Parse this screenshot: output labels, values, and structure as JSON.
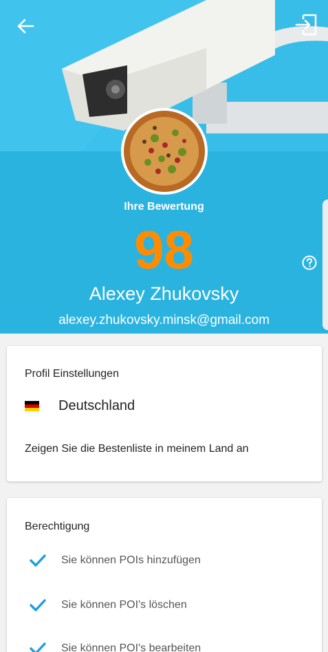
{
  "header": {
    "back_icon": "arrow-left-icon",
    "logout_icon": "exit-icon",
    "score_label": "Ihre Bewertung",
    "score": "98",
    "help_icon": "question-circle-icon",
    "user_name": "Alexey Zhukovsky",
    "user_email": "alexey.zhukovsky.minsk@gmail.com",
    "colors": {
      "background": "#2bb3e0",
      "score": "#ff8c00"
    }
  },
  "profile_settings": {
    "title": "Profil Einstellungen",
    "country": "Deutschland",
    "country_flag_icon": "germany-flag-icon",
    "leaderboard_text": "Zeigen Sie die Bestenliste in meinem Land an"
  },
  "permissions": {
    "title": "Berechtigung",
    "items": [
      {
        "label": "Sie können POIs hinzufügen"
      },
      {
        "label": "Sie können POI's löschen"
      },
      {
        "label": "Sie können POI's bearbeiten"
      }
    ],
    "check_color": "#1a9ee0"
  }
}
